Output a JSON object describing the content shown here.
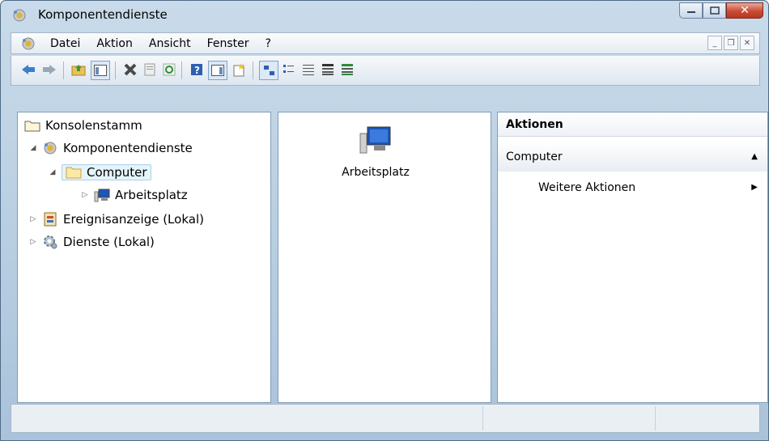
{
  "window": {
    "title": "Komponentendienste",
    "app_icon": "component-services-icon"
  },
  "menubar": {
    "items": [
      "Datei",
      "Aktion",
      "Ansicht",
      "Fenster",
      "?"
    ]
  },
  "toolbar": {
    "buttons": [
      "back-icon",
      "forward-icon",
      "up-folder-icon",
      "show-hide-console-tree-icon",
      "delete-icon",
      "properties-icon",
      "refresh-icon",
      "help-icon",
      "show-hide-action-pane-icon",
      "new-item-icon",
      "large-icons-view-icon",
      "small-icons-view-icon",
      "list-view-icon",
      "detail-view-icon",
      "property-view-icon"
    ]
  },
  "tree": {
    "root": "Konsolenstamm",
    "items": [
      {
        "label": "Komponentendienste",
        "icon": "component-services-icon"
      },
      {
        "label": "Computer",
        "icon": "folder-icon"
      },
      {
        "label": "Arbeitsplatz",
        "icon": "computer-icon"
      },
      {
        "label": "Ereignisanzeige (Lokal)",
        "icon": "event-viewer-icon"
      },
      {
        "label": "Dienste (Lokal)",
        "icon": "services-gear-icon"
      }
    ]
  },
  "content": {
    "items": [
      {
        "label": "Arbeitsplatz",
        "icon": "computer-icon"
      }
    ]
  },
  "actions": {
    "header": "Aktionen",
    "section": "Computer",
    "items": [
      "Weitere Aktionen"
    ]
  },
  "colors": {
    "title_gradient_top": "#c9dbea",
    "selection": "#e5f3fb",
    "close_button": "#c94b35"
  }
}
